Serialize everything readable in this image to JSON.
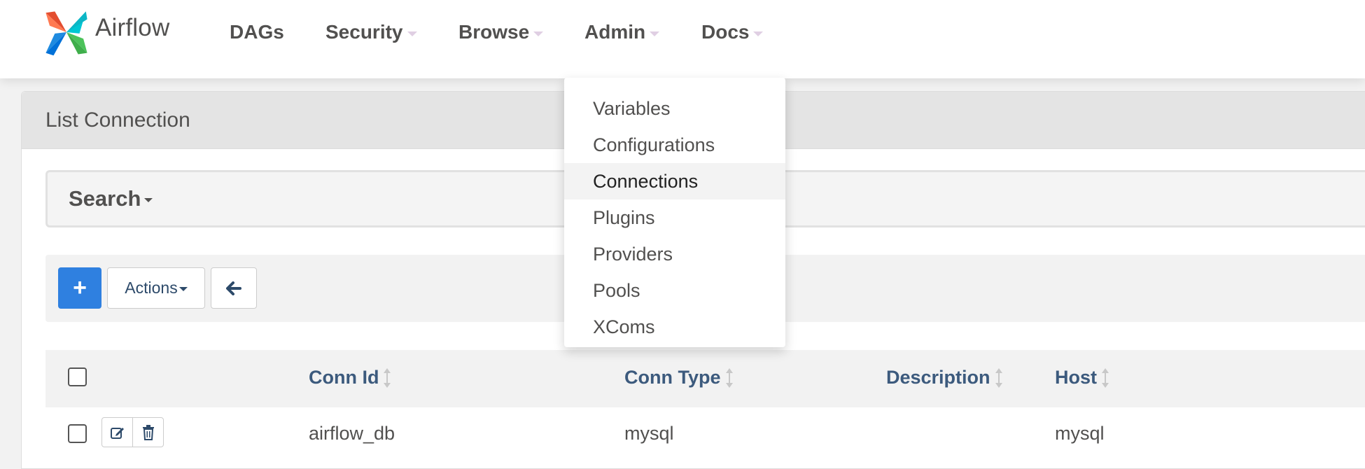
{
  "brand": {
    "name": "Airflow"
  },
  "nav": {
    "items": [
      {
        "label": "DAGs",
        "has_caret": false
      },
      {
        "label": "Security",
        "has_caret": true
      },
      {
        "label": "Browse",
        "has_caret": true
      },
      {
        "label": "Admin",
        "has_caret": true
      },
      {
        "label": "Docs",
        "has_caret": true
      }
    ]
  },
  "admin_menu": {
    "items": [
      {
        "label": "Variables"
      },
      {
        "label": "Configurations"
      },
      {
        "label": "Connections",
        "active": true
      },
      {
        "label": "Plugins"
      },
      {
        "label": "Providers"
      },
      {
        "label": "Pools"
      },
      {
        "label": "XComs"
      }
    ]
  },
  "panel": {
    "title": "List Connection"
  },
  "search": {
    "label": "Search"
  },
  "toolbar": {
    "add_label": "+",
    "actions_label": "Actions"
  },
  "table": {
    "columns": [
      "Conn Id",
      "Conn Type",
      "Description",
      "Host"
    ],
    "rows": [
      {
        "conn_id": "airflow_db",
        "conn_type": "mysql",
        "description": "",
        "host": "mysql"
      }
    ]
  },
  "colors": {
    "primary_button": "#2f80e0",
    "header_link": "#3c5a7d",
    "caret": "#e0cfe3"
  },
  "icons": [
    "airflow-logo-icon",
    "caret-down-icon",
    "plus-icon",
    "arrow-left-icon",
    "sort-icon",
    "edit-icon",
    "trash-icon"
  ]
}
